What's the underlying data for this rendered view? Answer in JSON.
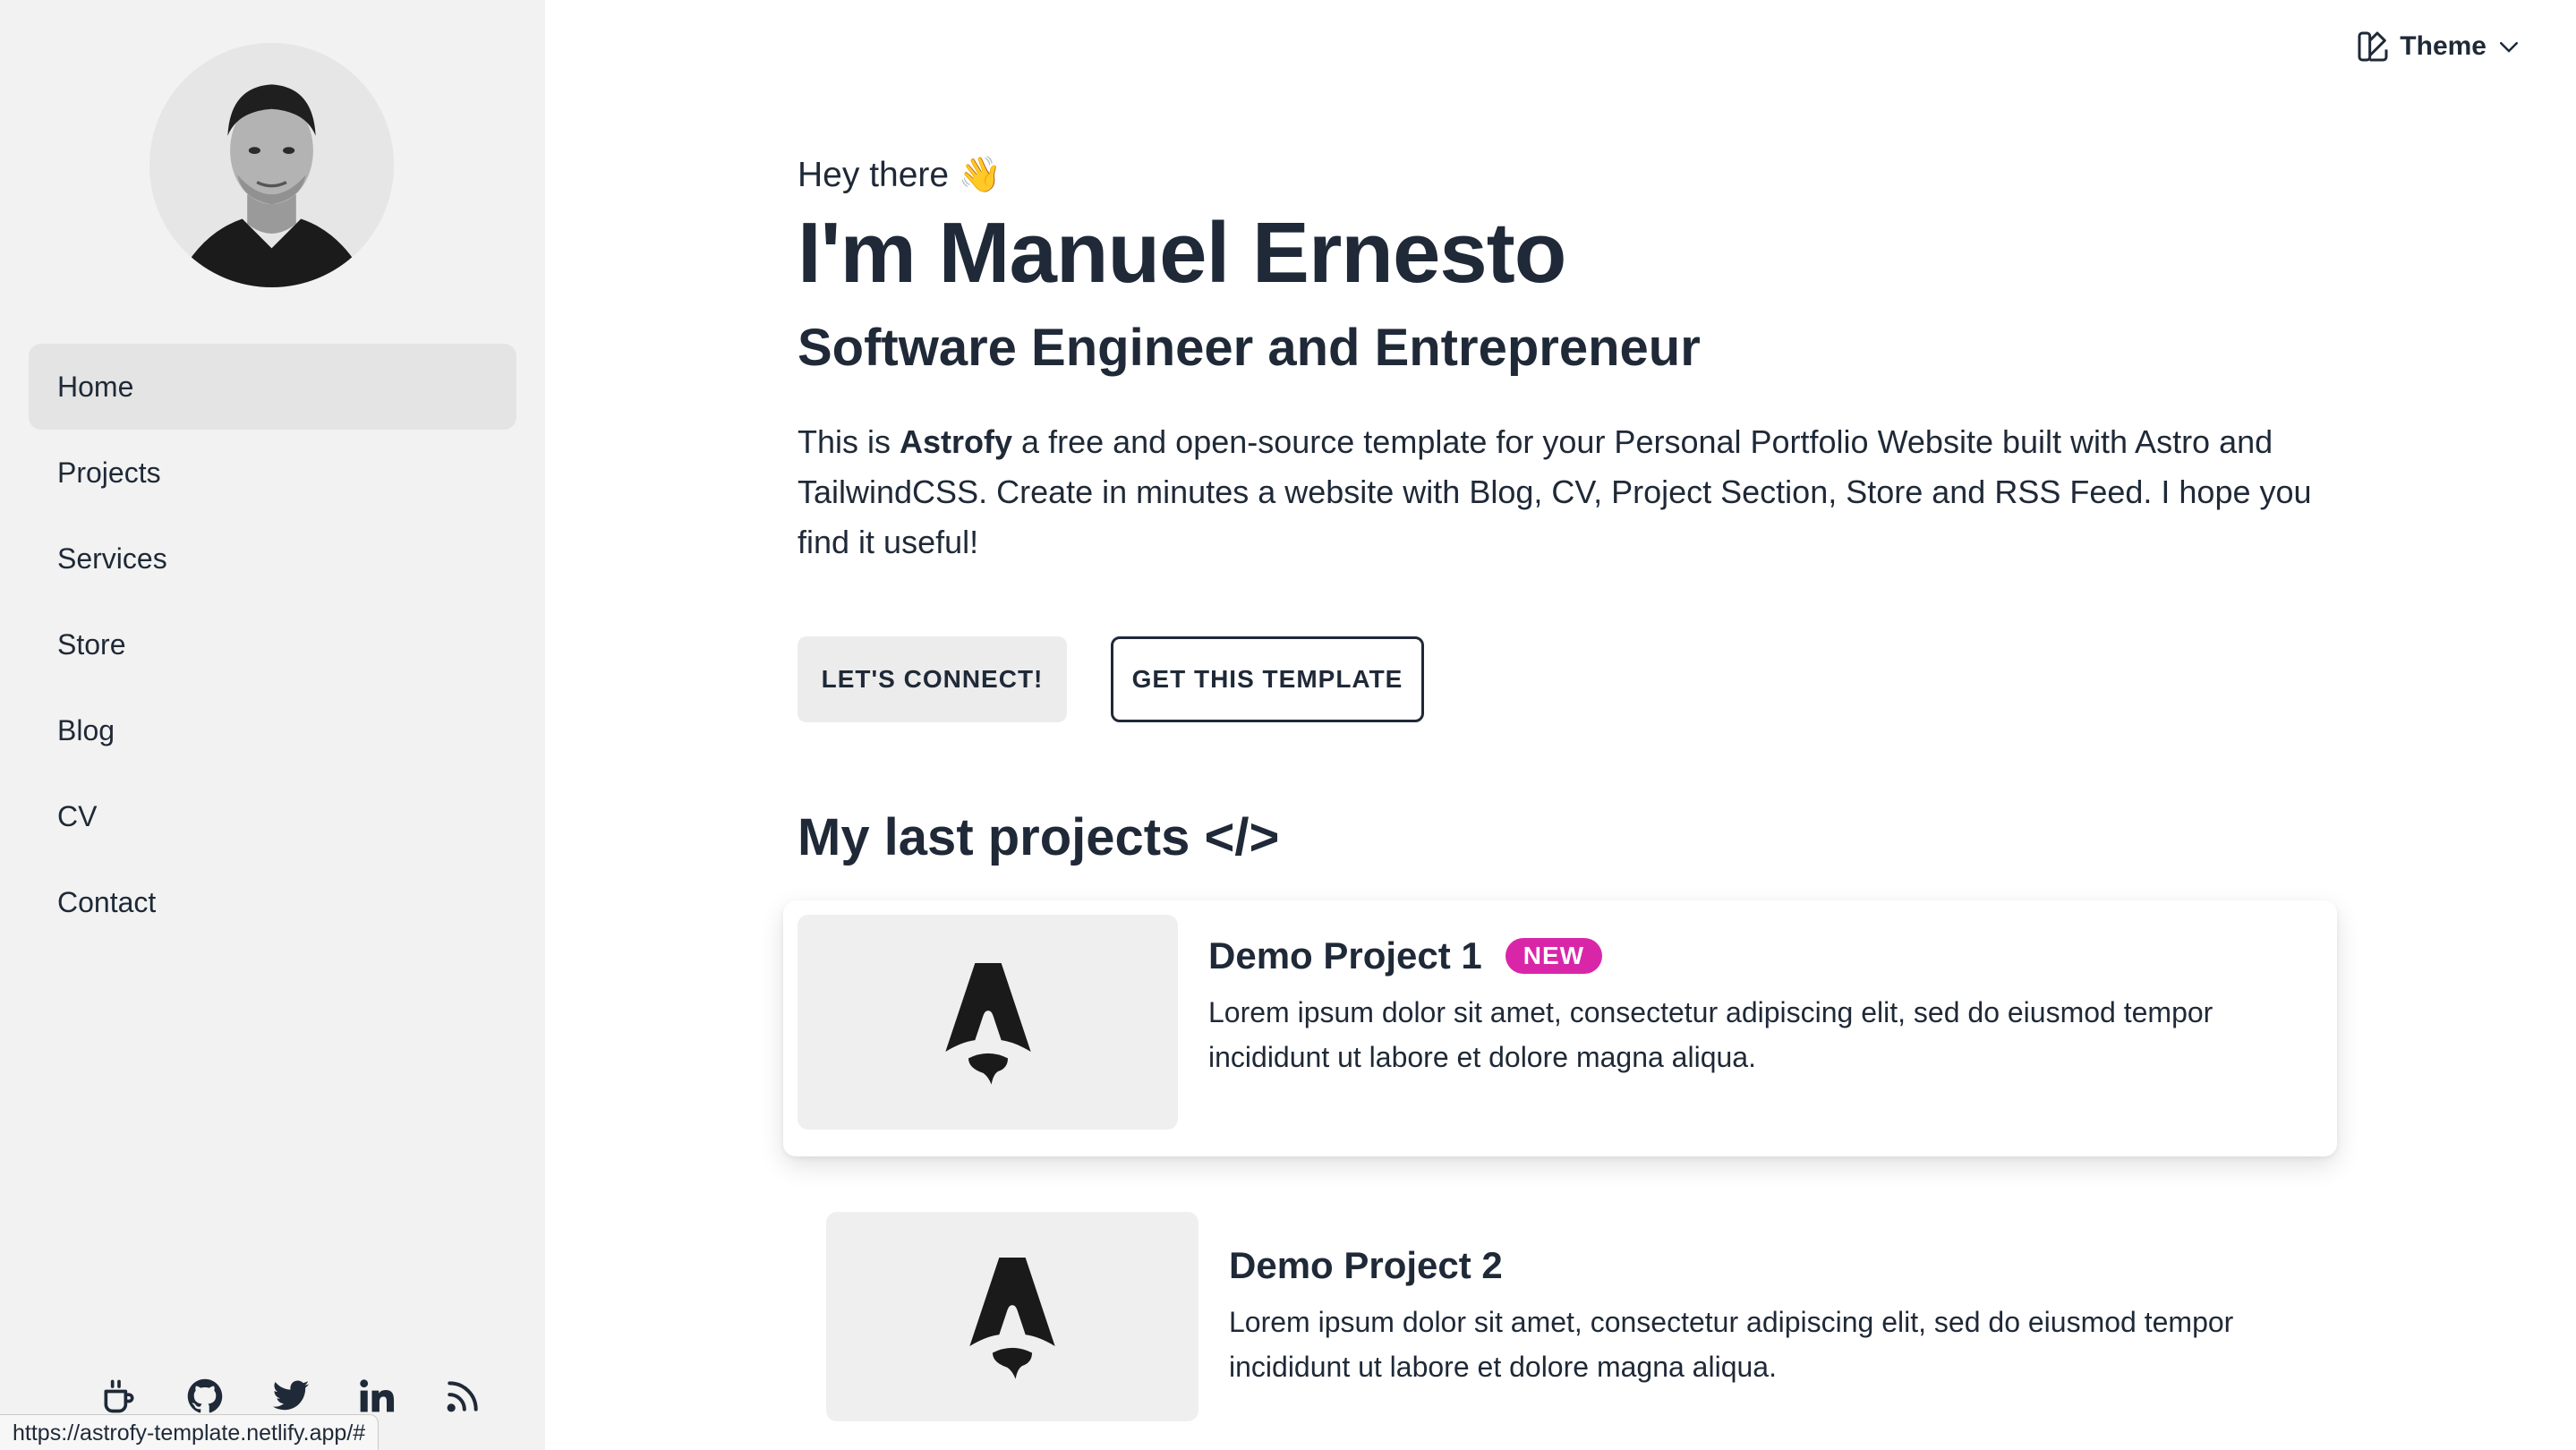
{
  "sidebar": {
    "nav": [
      {
        "label": "Home",
        "active": true
      },
      {
        "label": "Projects"
      },
      {
        "label": "Services"
      },
      {
        "label": "Store"
      },
      {
        "label": "Blog"
      },
      {
        "label": "CV"
      },
      {
        "label": "Contact"
      }
    ],
    "socials": [
      "coffee-icon",
      "github-icon",
      "twitter-icon",
      "linkedin-icon",
      "rss-icon"
    ],
    "status_url": "https://astrofy-template.netlify.app/#"
  },
  "header": {
    "theme_label": "Theme"
  },
  "hero": {
    "greeting": "Hey there 👋",
    "title": "I'm Manuel Ernesto",
    "subtitle": "Software Engineer and Entrepreneur",
    "intro_prefix": "This is ",
    "intro_brand": "Astrofy",
    "intro_suffix": " a free and open-source template for your Personal Portfolio Website built with Astro and TailwindCSS. Create in minutes a website with Blog, CV, Project Section, Store and RSS Feed. I hope you find it useful!",
    "buttons": {
      "connect": "LET'S CONNECT!",
      "template": "GET THIS TEMPLATE"
    }
  },
  "projects": {
    "section_title": "My last projects </>",
    "items": [
      {
        "title": "Demo Project 1",
        "badge": "NEW",
        "description": "Lorem ipsum dolor sit amet, consectetur adipiscing elit, sed do eiusmod tempor incididunt ut labore et dolore magna aliqua."
      },
      {
        "title": "Demo Project 2",
        "description": "Lorem ipsum dolor sit amet, consectetur adipiscing elit, sed do eiusmod tempor incididunt ut labore et dolore magna aliqua."
      }
    ]
  },
  "colors": {
    "sidebar_bg": "#f2f2f2",
    "active_nav_bg": "#e4e4e4",
    "text": "#1f2937",
    "badge": "#d926a9",
    "thumb_bg": "#efefef"
  }
}
